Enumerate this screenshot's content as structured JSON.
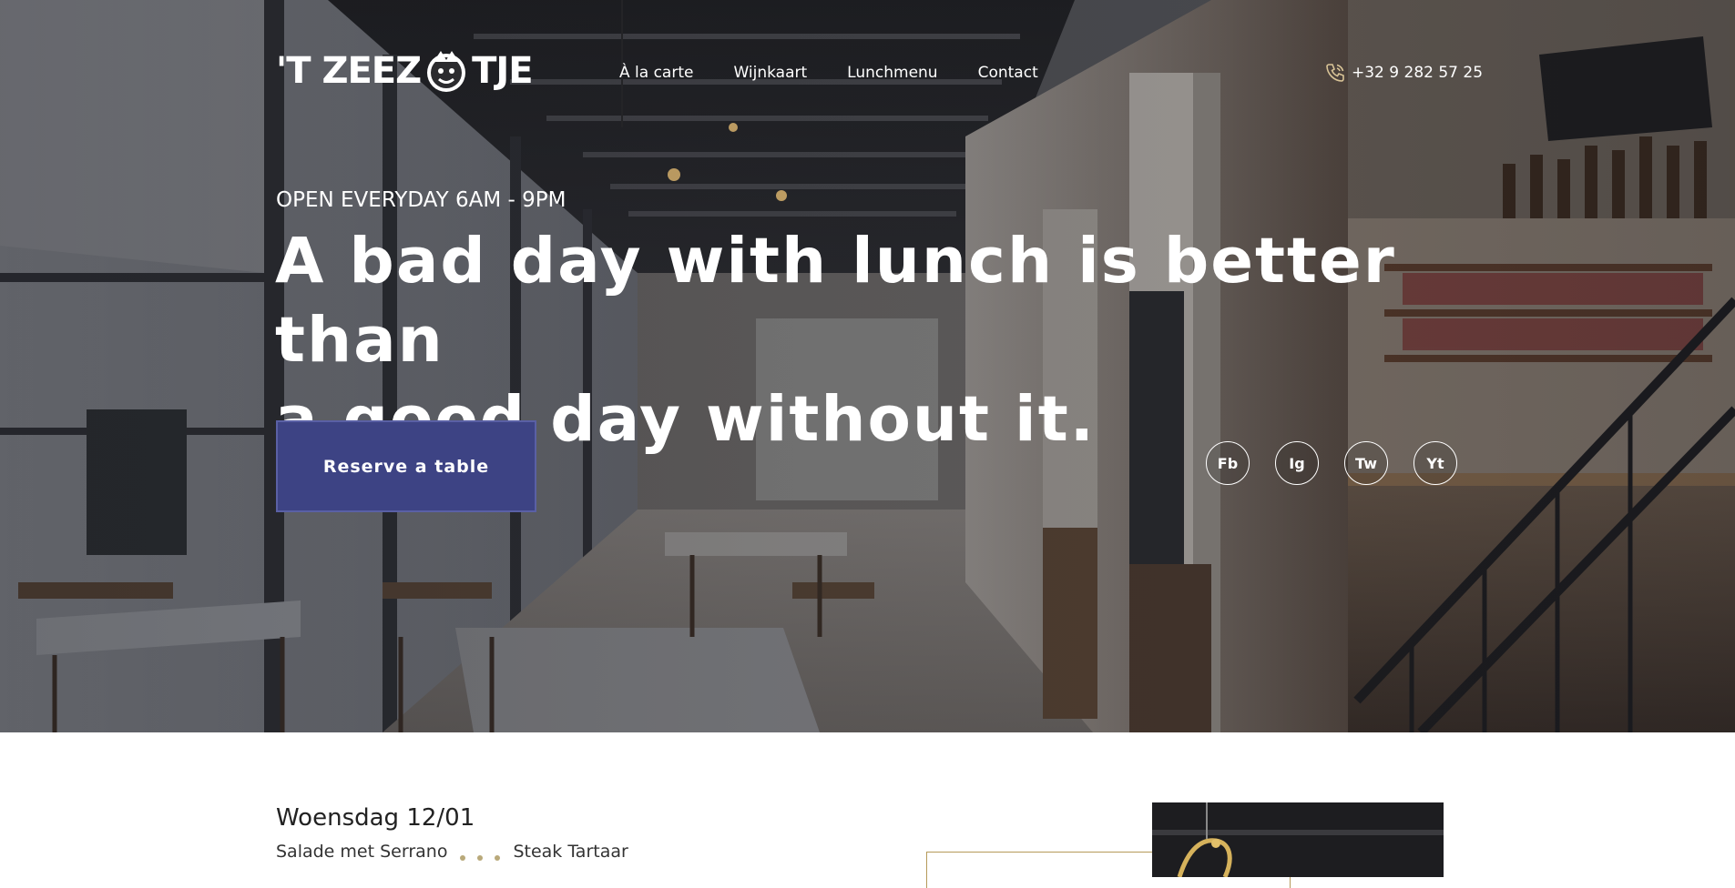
{
  "header": {
    "logo_text_left": "'T ZEEZ",
    "logo_text_right": "TJE",
    "nav": [
      {
        "label": "À la carte"
      },
      {
        "label": "Wijnkaart"
      },
      {
        "label": "Lunchmenu"
      },
      {
        "label": "Contact"
      }
    ],
    "phone": "+32 9 282 57 25"
  },
  "hero": {
    "hours": "OPEN EVERYDAY 6AM - 9PM",
    "headline_line1": "A bad day with lunch is better than",
    "headline_line2": "a good day without it.",
    "cta_label": "Reserve a table",
    "socials": [
      {
        "label": "Fb"
      },
      {
        "label": "Ig"
      },
      {
        "label": "Tw"
      },
      {
        "label": "Yt"
      }
    ]
  },
  "lunch": {
    "day_title": "Woensdag 12/01",
    "item_left": "Salade met Serrano",
    "item_right": "Steak Tartaar"
  },
  "colors": {
    "accent": "#3d4384",
    "gold": "#b59a5a"
  },
  "icons": {
    "phone": "phone-icon",
    "logo_mark": "jester-logo-icon"
  }
}
